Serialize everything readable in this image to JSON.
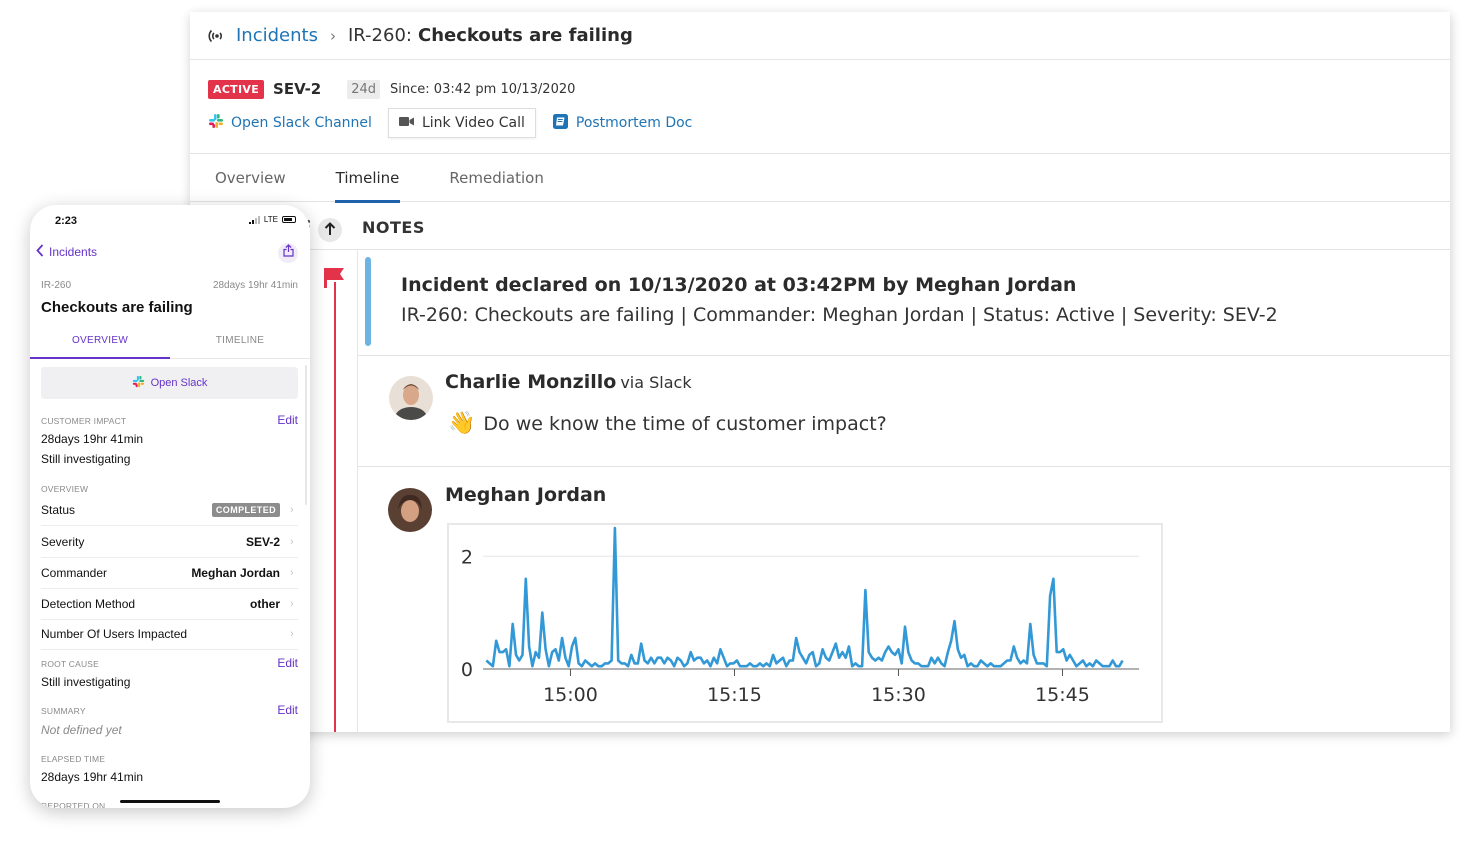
{
  "desktop": {
    "breadcrumb": {
      "icon": "incident-broadcast-icon",
      "root": "Incidents",
      "separator": "›",
      "id": "IR-260:",
      "title": "Checkouts are failing"
    },
    "meta": {
      "status_badge": "ACTIVE",
      "severity": "SEV-2",
      "duration": "24d",
      "since": "Since: 03:42 pm 10/13/2020",
      "actions": {
        "slack": "Open Slack Channel",
        "video": "Link Video Call",
        "postmortem": "Postmortem Doc"
      }
    },
    "tabs": [
      {
        "label": "Overview",
        "active": false
      },
      {
        "label": "Timeline",
        "active": true
      },
      {
        "label": "Remediation",
        "active": false
      }
    ],
    "timeline": {
      "section_title": "NOTES",
      "declared": {
        "title": "Incident declared on 10/13/2020 at 03:42PM by Meghan Jordan",
        "details": "IR-260: Checkouts are failing | Commander: Meghan Jordan | Status: Active | Severity: SEV-2"
      },
      "messages": [
        {
          "author": "Charlie Monzillo",
          "source": "via Slack",
          "emoji": "👋",
          "text": "Do we know the time of customer impact?"
        },
        {
          "author": "Meghan Jordan",
          "source": "",
          "attachment": "graph"
        }
      ]
    },
    "colors": {
      "link": "#1f74b5",
      "active_badge": "#e3334a",
      "timeline_line": "#e3334a",
      "declared_bar": "#6fb3e3",
      "tab_underline": "#1f63ad",
      "series": "#3399d6"
    }
  },
  "chart_data": {
    "type": "line",
    "title": "",
    "xlabel": "",
    "ylabel": "",
    "x_range": [
      "14:52",
      "15:52"
    ],
    "x_tick_labels": [
      "15:00",
      "15:15",
      "15:30",
      "15:45"
    ],
    "y_tick_labels": [
      "0",
      "2"
    ],
    "ylim": [
      0,
      2.2
    ],
    "grid": true,
    "legend": "none",
    "series": [
      {
        "name": "series-1",
        "x_step_minutes": 0.33,
        "values": [
          0.15,
          0.1,
          0.05,
          0.5,
          0.3,
          0.3,
          0.35,
          0.05,
          0.8,
          0.25,
          0.15,
          0.25,
          1.6,
          0.4,
          0.05,
          0.3,
          0.2,
          1.0,
          0.35,
          0.05,
          0.3,
          0.35,
          0.15,
          0.55,
          0.2,
          0.05,
          0.4,
          0.55,
          0.1,
          0.05,
          0.15,
          0.1,
          0.05,
          0.1,
          0.05,
          0.05,
          0.1,
          0.1,
          0.15,
          2.5,
          0.15,
          0.1,
          0.1,
          0.05,
          0.25,
          0.1,
          0.1,
          0.45,
          0.15,
          0.1,
          0.2,
          0.1,
          0.2,
          0.2,
          0.1,
          0.2,
          0.15,
          0.05,
          0.2,
          0.15,
          0.05,
          0.1,
          0.3,
          0.15,
          0.2,
          0.2,
          0.1,
          0.15,
          0.05,
          0.2,
          0.1,
          0.35,
          0.2,
          0.05,
          0.1,
          0.1,
          0.15,
          0.05,
          0.05,
          0.05,
          0.1,
          0.05,
          0.05,
          0.1,
          0.05,
          0.1,
          0.05,
          0.25,
          0.1,
          0.15,
          0.2,
          0.05,
          0.15,
          0.15,
          0.55,
          0.3,
          0.2,
          0.1,
          0.25,
          0.3,
          0.05,
          0.1,
          0.35,
          0.2,
          0.15,
          0.3,
          0.45,
          0.2,
          0.3,
          0.2,
          0.4,
          0.05,
          0.1,
          0.05,
          0.05,
          1.4,
          0.3,
          0.2,
          0.15,
          0.2,
          0.15,
          0.3,
          0.4,
          0.3,
          0.25,
          0.35,
          0.1,
          0.75,
          0.3,
          0.15,
          0.1,
          0.1,
          0.05,
          0.05,
          0.05,
          0.2,
          0.1,
          0.2,
          0.1,
          0.05,
          0.3,
          0.5,
          0.85,
          0.35,
          0.2,
          0.25,
          0.05,
          0.1,
          0.05,
          0.05,
          0.15,
          0.1,
          0.05,
          0.1,
          0.05,
          0.05,
          0.05,
          0.1,
          0.15,
          0.15,
          0.4,
          0.2,
          0.1,
          0.15,
          0.1,
          0.8,
          0.25,
          0.1,
          0.1,
          0.1,
          0.05,
          1.3,
          1.6,
          0.3,
          0.3,
          0.35,
          0.15,
          0.25,
          0.15,
          0.05,
          0.1,
          0.15,
          0.05,
          0.1,
          0.05,
          0.15,
          0.1,
          0.05,
          0.05,
          0.05,
          0.15,
          0.05,
          0.05,
          0.15
        ]
      }
    ]
  },
  "mobile": {
    "status_bar": {
      "time": "2:23",
      "network": "LTE"
    },
    "nav": {
      "back_label": "Incidents"
    },
    "incident_id": "IR-260",
    "elapsed_short": "28days 19hr 41min",
    "title": "Checkouts are failing",
    "tabs": [
      {
        "label": "OVERVIEW",
        "active": true
      },
      {
        "label": "TIMELINE",
        "active": false
      }
    ],
    "open_slack": "Open Slack",
    "customer_impact": {
      "label": "CUSTOMER IMPACT",
      "edit": "Edit",
      "duration": "28days 19hr 41min",
      "status": "Still investigating"
    },
    "overview": {
      "label": "OVERVIEW",
      "rows": [
        {
          "label": "Status",
          "value": "COMPLETED",
          "type": "badge"
        },
        {
          "label": "Severity",
          "value": "SEV-2"
        },
        {
          "label": "Commander",
          "value": "Meghan Jordan"
        },
        {
          "label": "Detection Method",
          "value": "other"
        },
        {
          "label": "Number Of Users Impacted",
          "value": ""
        }
      ]
    },
    "root_cause": {
      "label": "ROOT CAUSE",
      "edit": "Edit",
      "value": "Still investigating"
    },
    "summary": {
      "label": "SUMMARY",
      "edit": "Edit",
      "value": "Not defined yet"
    },
    "elapsed_time": {
      "label": "ELAPSED TIME",
      "value": "28days 19hr 41min"
    },
    "reported_on": {
      "label": "REPORTED ON"
    },
    "colors": {
      "accent": "#6533c9",
      "badge": "#8c8c8c"
    }
  }
}
